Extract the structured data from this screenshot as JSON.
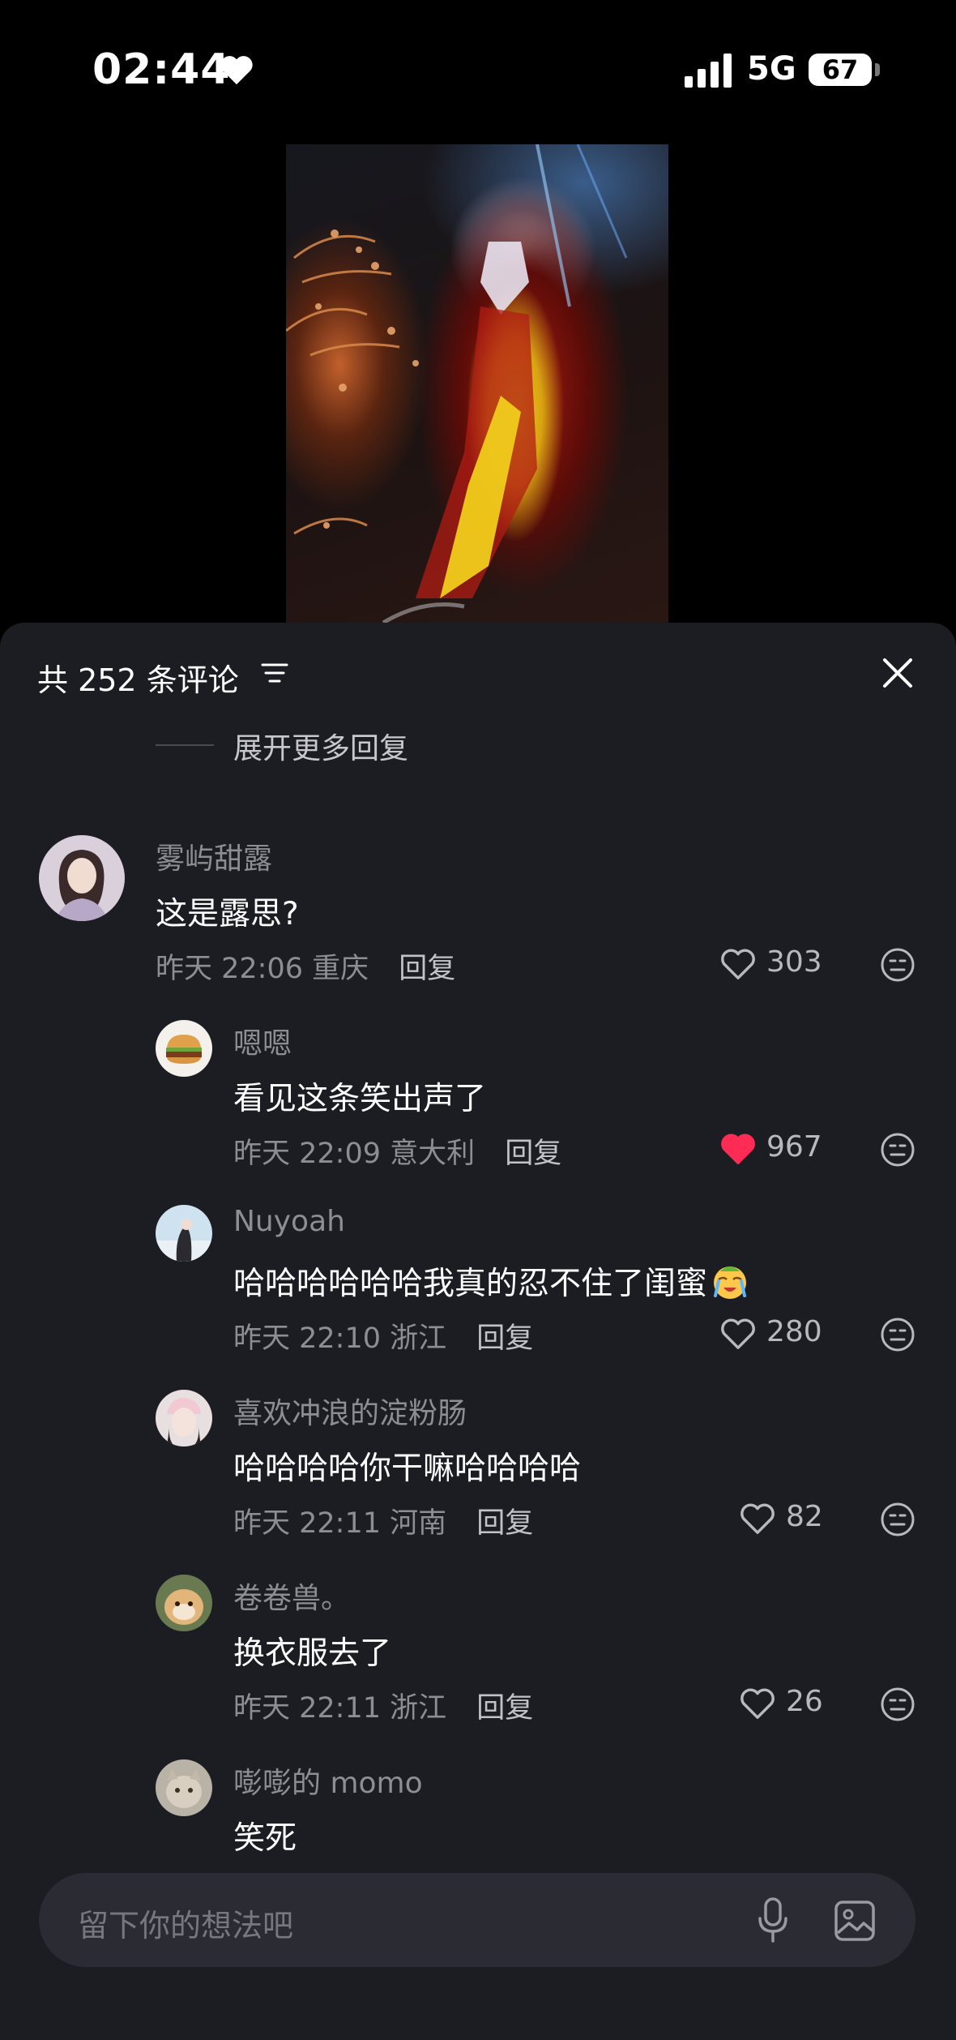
{
  "status_bar": {
    "time": "02:44",
    "network": "5G",
    "battery": "67"
  },
  "comments_panel": {
    "title": "共 252 条评论",
    "expand_more": "展开更多回复",
    "comments": [
      {
        "username": "雾屿甜露",
        "text": "这是露思?",
        "time": "昨天 22:06",
        "location": "重庆",
        "reply": "回复",
        "likes": "303",
        "liked": false,
        "level": "root"
      },
      {
        "username": "嗯嗯",
        "text": "看见这条笑出声了",
        "time": "昨天 22:09",
        "location": "意大利",
        "reply": "回复",
        "likes": "967",
        "liked": true,
        "level": "sub"
      },
      {
        "username": "Nuyoah",
        "text": "哈哈哈哈哈哈我真的忍不住了闺蜜",
        "time": "昨天 22:10",
        "location": "浙江",
        "reply": "回复",
        "likes": "280",
        "liked": false,
        "level": "sub"
      },
      {
        "username": "喜欢冲浪的淀粉肠",
        "text": "哈哈哈哈你干嘛哈哈哈哈",
        "time": "昨天 22:11",
        "location": "河南",
        "reply": "回复",
        "likes": "82",
        "liked": false,
        "level": "sub"
      },
      {
        "username": "卷卷兽。",
        "text": "换衣服去了",
        "time": "昨天 22:11",
        "location": "浙江",
        "reply": "回复",
        "likes": "26",
        "liked": false,
        "level": "sub"
      },
      {
        "username": "嘭嘭的 momo",
        "text": "笑死",
        "level": "sub"
      }
    ]
  },
  "input": {
    "placeholder": "留下你的想法吧"
  },
  "colors": {
    "like_active": "#fe2c55",
    "panel_bg": "#1c1c23",
    "secondary_text": "#8d8d94"
  },
  "icons": {
    "status_heart": "heart-icon",
    "filter": "filter-icon",
    "close": "close-icon",
    "like": "heart-icon",
    "emoji": "emoji-icon",
    "mic": "microphone-icon",
    "image": "image-icon"
  }
}
